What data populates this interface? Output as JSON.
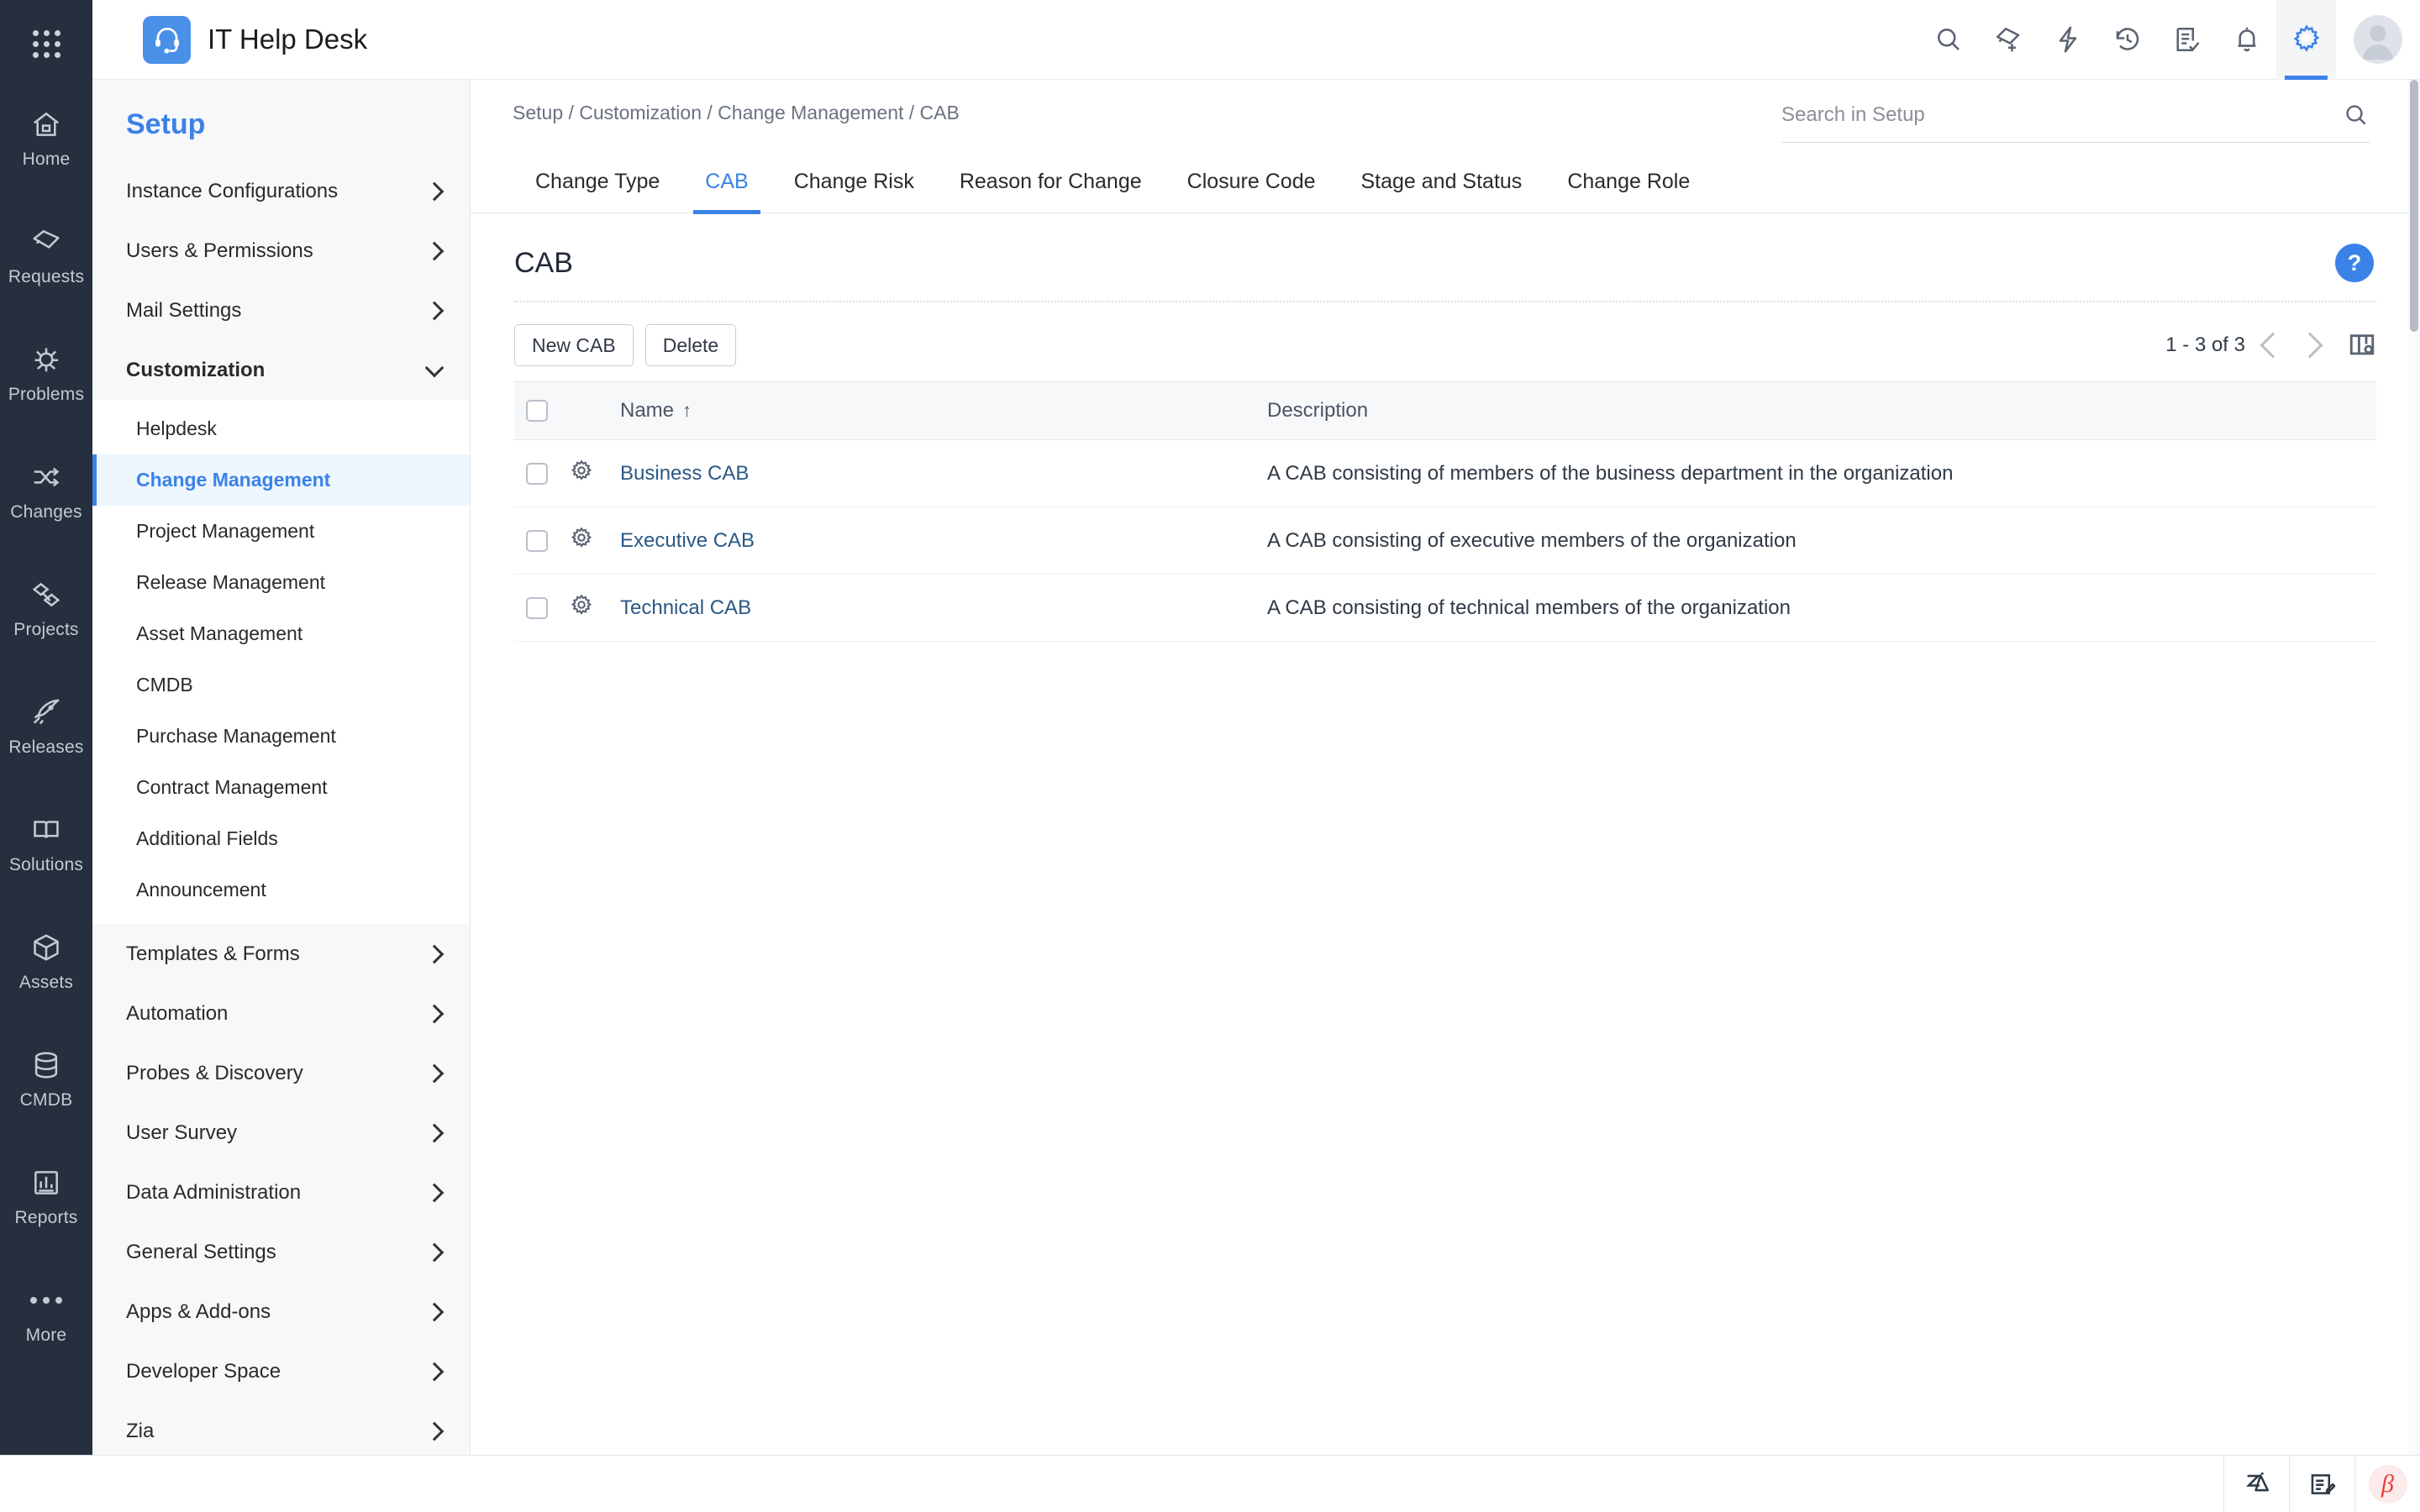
{
  "rail": {
    "apps_icon": "apps-grid-icon",
    "items": [
      {
        "label": "Home",
        "icon": "home-icon"
      },
      {
        "label": "Requests",
        "icon": "ticket-icon"
      },
      {
        "label": "Problems",
        "icon": "bug-icon"
      },
      {
        "label": "Changes",
        "icon": "shuffle-icon"
      },
      {
        "label": "Projects",
        "icon": "projects-icon"
      },
      {
        "label": "Releases",
        "icon": "rocket-icon"
      },
      {
        "label": "Solutions",
        "icon": "book-icon"
      },
      {
        "label": "Assets",
        "icon": "cube-icon"
      },
      {
        "label": "CMDB",
        "icon": "database-icon"
      },
      {
        "label": "Reports",
        "icon": "bar-chart-icon"
      },
      {
        "label": "More",
        "icon": "ellipsis-icon"
      }
    ]
  },
  "header": {
    "app_title": "IT Help Desk",
    "logo_icon": "headset-icon",
    "actions": [
      {
        "name": "search-icon",
        "label": "Search"
      },
      {
        "name": "add-ticket-icon",
        "label": "Add Request"
      },
      {
        "name": "quick-actions-icon",
        "label": "Quick Actions"
      },
      {
        "name": "history-icon",
        "label": "Recent Items"
      },
      {
        "name": "tasks-icon",
        "label": "Tasks"
      },
      {
        "name": "notifications-icon",
        "label": "Notifications"
      },
      {
        "name": "settings-icon",
        "label": "Setup"
      }
    ],
    "avatar": "user-avatar"
  },
  "setup_sidebar": {
    "title": "Setup",
    "groups": [
      {
        "label": "Instance Configurations",
        "expanded": false
      },
      {
        "label": "Users & Permissions",
        "expanded": false
      },
      {
        "label": "Mail Settings",
        "expanded": false
      },
      {
        "label": "Customization",
        "expanded": true,
        "items": [
          {
            "label": "Helpdesk",
            "active": false
          },
          {
            "label": "Change Management",
            "active": true
          },
          {
            "label": "Project Management",
            "active": false
          },
          {
            "label": "Release Management",
            "active": false
          },
          {
            "label": "Asset Management",
            "active": false
          },
          {
            "label": "CMDB",
            "active": false
          },
          {
            "label": "Purchase Management",
            "active": false
          },
          {
            "label": "Contract Management",
            "active": false
          },
          {
            "label": "Additional Fields",
            "active": false
          },
          {
            "label": "Announcement",
            "active": false
          }
        ]
      },
      {
        "label": "Templates & Forms",
        "expanded": false
      },
      {
        "label": "Automation",
        "expanded": false
      },
      {
        "label": "Probes & Discovery",
        "expanded": false
      },
      {
        "label": "User Survey",
        "expanded": false
      },
      {
        "label": "Data Administration",
        "expanded": false
      },
      {
        "label": "General Settings",
        "expanded": false
      },
      {
        "label": "Apps & Add-ons",
        "expanded": false
      },
      {
        "label": "Developer Space",
        "expanded": false
      },
      {
        "label": "Zia",
        "expanded": false
      }
    ]
  },
  "main": {
    "breadcrumb": "Setup / Customization / Change Management / CAB",
    "search": {
      "placeholder": "Search in Setup",
      "value": ""
    },
    "tabs": [
      {
        "label": "Change Type",
        "active": false
      },
      {
        "label": "CAB",
        "active": true
      },
      {
        "label": "Change Risk",
        "active": false
      },
      {
        "label": "Reason for Change",
        "active": false
      },
      {
        "label": "Closure Code",
        "active": false
      },
      {
        "label": "Stage and Status",
        "active": false
      },
      {
        "label": "Change Role",
        "active": false
      }
    ],
    "page_title": "CAB",
    "help_label": "?",
    "toolbar": {
      "new_label": "New CAB",
      "delete_label": "Delete"
    },
    "pagination": {
      "range_text": "1 - 3 of 3",
      "prev_icon": "chevron-left-icon",
      "next_icon": "chevron-right-icon",
      "columns_icon": "column-settings-icon"
    },
    "table": {
      "columns": [
        "",
        "",
        "Name",
        "Description"
      ],
      "sort_column": "Name",
      "sort_direction": "ascending",
      "sort_glyph": "↑",
      "rows": [
        {
          "name": "Business CAB",
          "description": "A CAB consisting of members of the business department in the organization"
        },
        {
          "name": "Executive CAB",
          "description": "A CAB consisting of executive members of the organization"
        },
        {
          "name": "Technical CAB",
          "description": "A CAB consisting of technical members of the organization"
        }
      ]
    }
  },
  "bottombar": {
    "items": [
      {
        "name": "zia-icon",
        "label": "Zia"
      },
      {
        "name": "feedback-icon",
        "label": "Feedback"
      },
      {
        "name": "beta-badge",
        "label": "β"
      }
    ]
  },
  "colors": {
    "accent": "#3b82e8",
    "rail_bg": "#262f3d",
    "sidebar_bg": "#f7f8f9",
    "link": "#2a5885",
    "beta_red": "#e8413c"
  }
}
